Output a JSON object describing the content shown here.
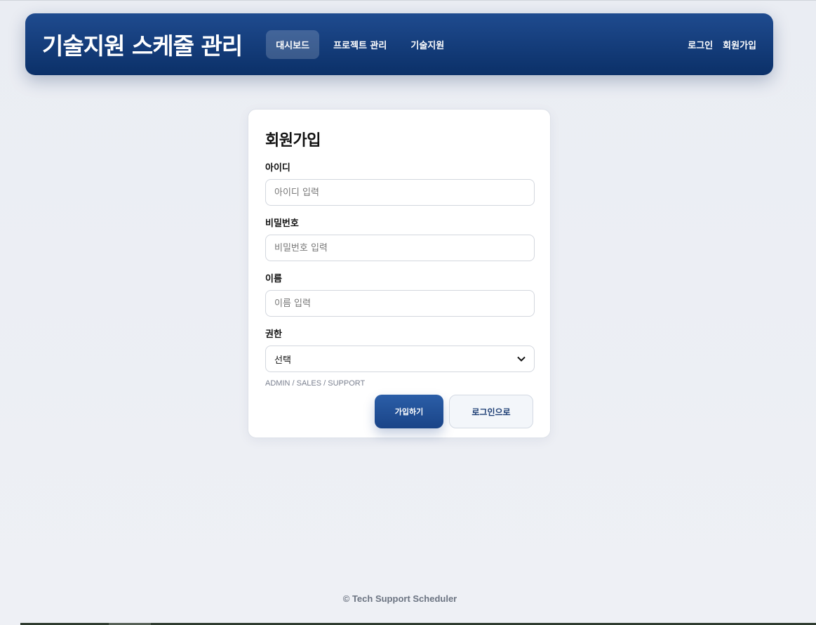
{
  "navbar": {
    "brand": "기술지원 스케줄 관리",
    "links": [
      {
        "label": "대시보드",
        "active": true
      },
      {
        "label": "프로젝트 관리",
        "active": false
      },
      {
        "label": "기술지원",
        "active": false
      }
    ],
    "right_links": [
      {
        "label": "로그인"
      },
      {
        "label": "회원가입"
      }
    ]
  },
  "form": {
    "title": "회원가입",
    "fields": {
      "username": {
        "label": "아이디",
        "placeholder": "아이디 입력",
        "value": ""
      },
      "password": {
        "label": "비밀번호",
        "placeholder": "비밀번호 입력",
        "value": ""
      },
      "name": {
        "label": "이름",
        "placeholder": "이름 입력",
        "value": ""
      },
      "role": {
        "label": "권한",
        "selected": "선택",
        "hint": "ADMIN / SALES / SUPPORT"
      }
    },
    "buttons": {
      "submit": "가입하기",
      "to_login": "로그인으로"
    }
  },
  "footer": {
    "text": "© Tech Support Scheduler"
  },
  "colors": {
    "nav_top": "#1f4b8f",
    "nav_bottom": "#0b3068",
    "primary": "#2b5ea8",
    "background": "#eef0f5"
  },
  "icons": {
    "select_chevron": "chevron-down-icon"
  }
}
